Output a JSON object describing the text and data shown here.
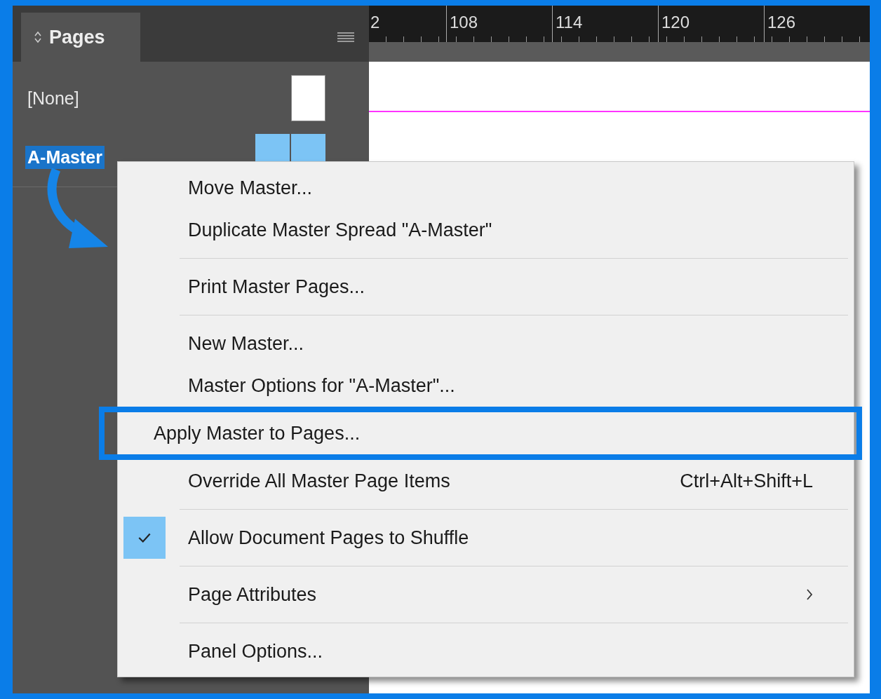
{
  "panel": {
    "title": "Pages",
    "masters": [
      {
        "label": "[None]",
        "selected": false,
        "kind": "single"
      },
      {
        "label": "A-Master",
        "selected": true,
        "kind": "spread"
      }
    ]
  },
  "ruler": {
    "labels": [
      "2",
      "108",
      "114",
      "120",
      "126"
    ]
  },
  "context_menu": {
    "groups": [
      [
        {
          "label": "Move Master...",
          "checked": false,
          "highlighted": false,
          "submenu": false
        },
        {
          "label": "Duplicate Master Spread \"A-Master\"",
          "checked": false,
          "highlighted": false,
          "submenu": false
        }
      ],
      [
        {
          "label": "Print Master Pages...",
          "checked": false,
          "highlighted": false,
          "submenu": false
        }
      ],
      [
        {
          "label": "New Master...",
          "checked": false,
          "highlighted": false,
          "submenu": false
        },
        {
          "label": "Master Options for \"A-Master\"...",
          "checked": false,
          "highlighted": false,
          "submenu": false
        },
        {
          "label": "Apply Master to Pages...",
          "checked": false,
          "highlighted": true,
          "submenu": false
        },
        {
          "label": "Override All Master Page Items",
          "shortcut": "Ctrl+Alt+Shift+L",
          "checked": false,
          "highlighted": false,
          "submenu": false
        }
      ],
      [
        {
          "label": "Allow Document Pages to Shuffle",
          "checked": true,
          "highlighted": false,
          "submenu": false
        }
      ],
      [
        {
          "label": "Page Attributes",
          "checked": false,
          "highlighted": false,
          "submenu": true
        }
      ],
      [
        {
          "label": "Panel Options...",
          "checked": false,
          "highlighted": false,
          "submenu": false
        }
      ]
    ]
  }
}
